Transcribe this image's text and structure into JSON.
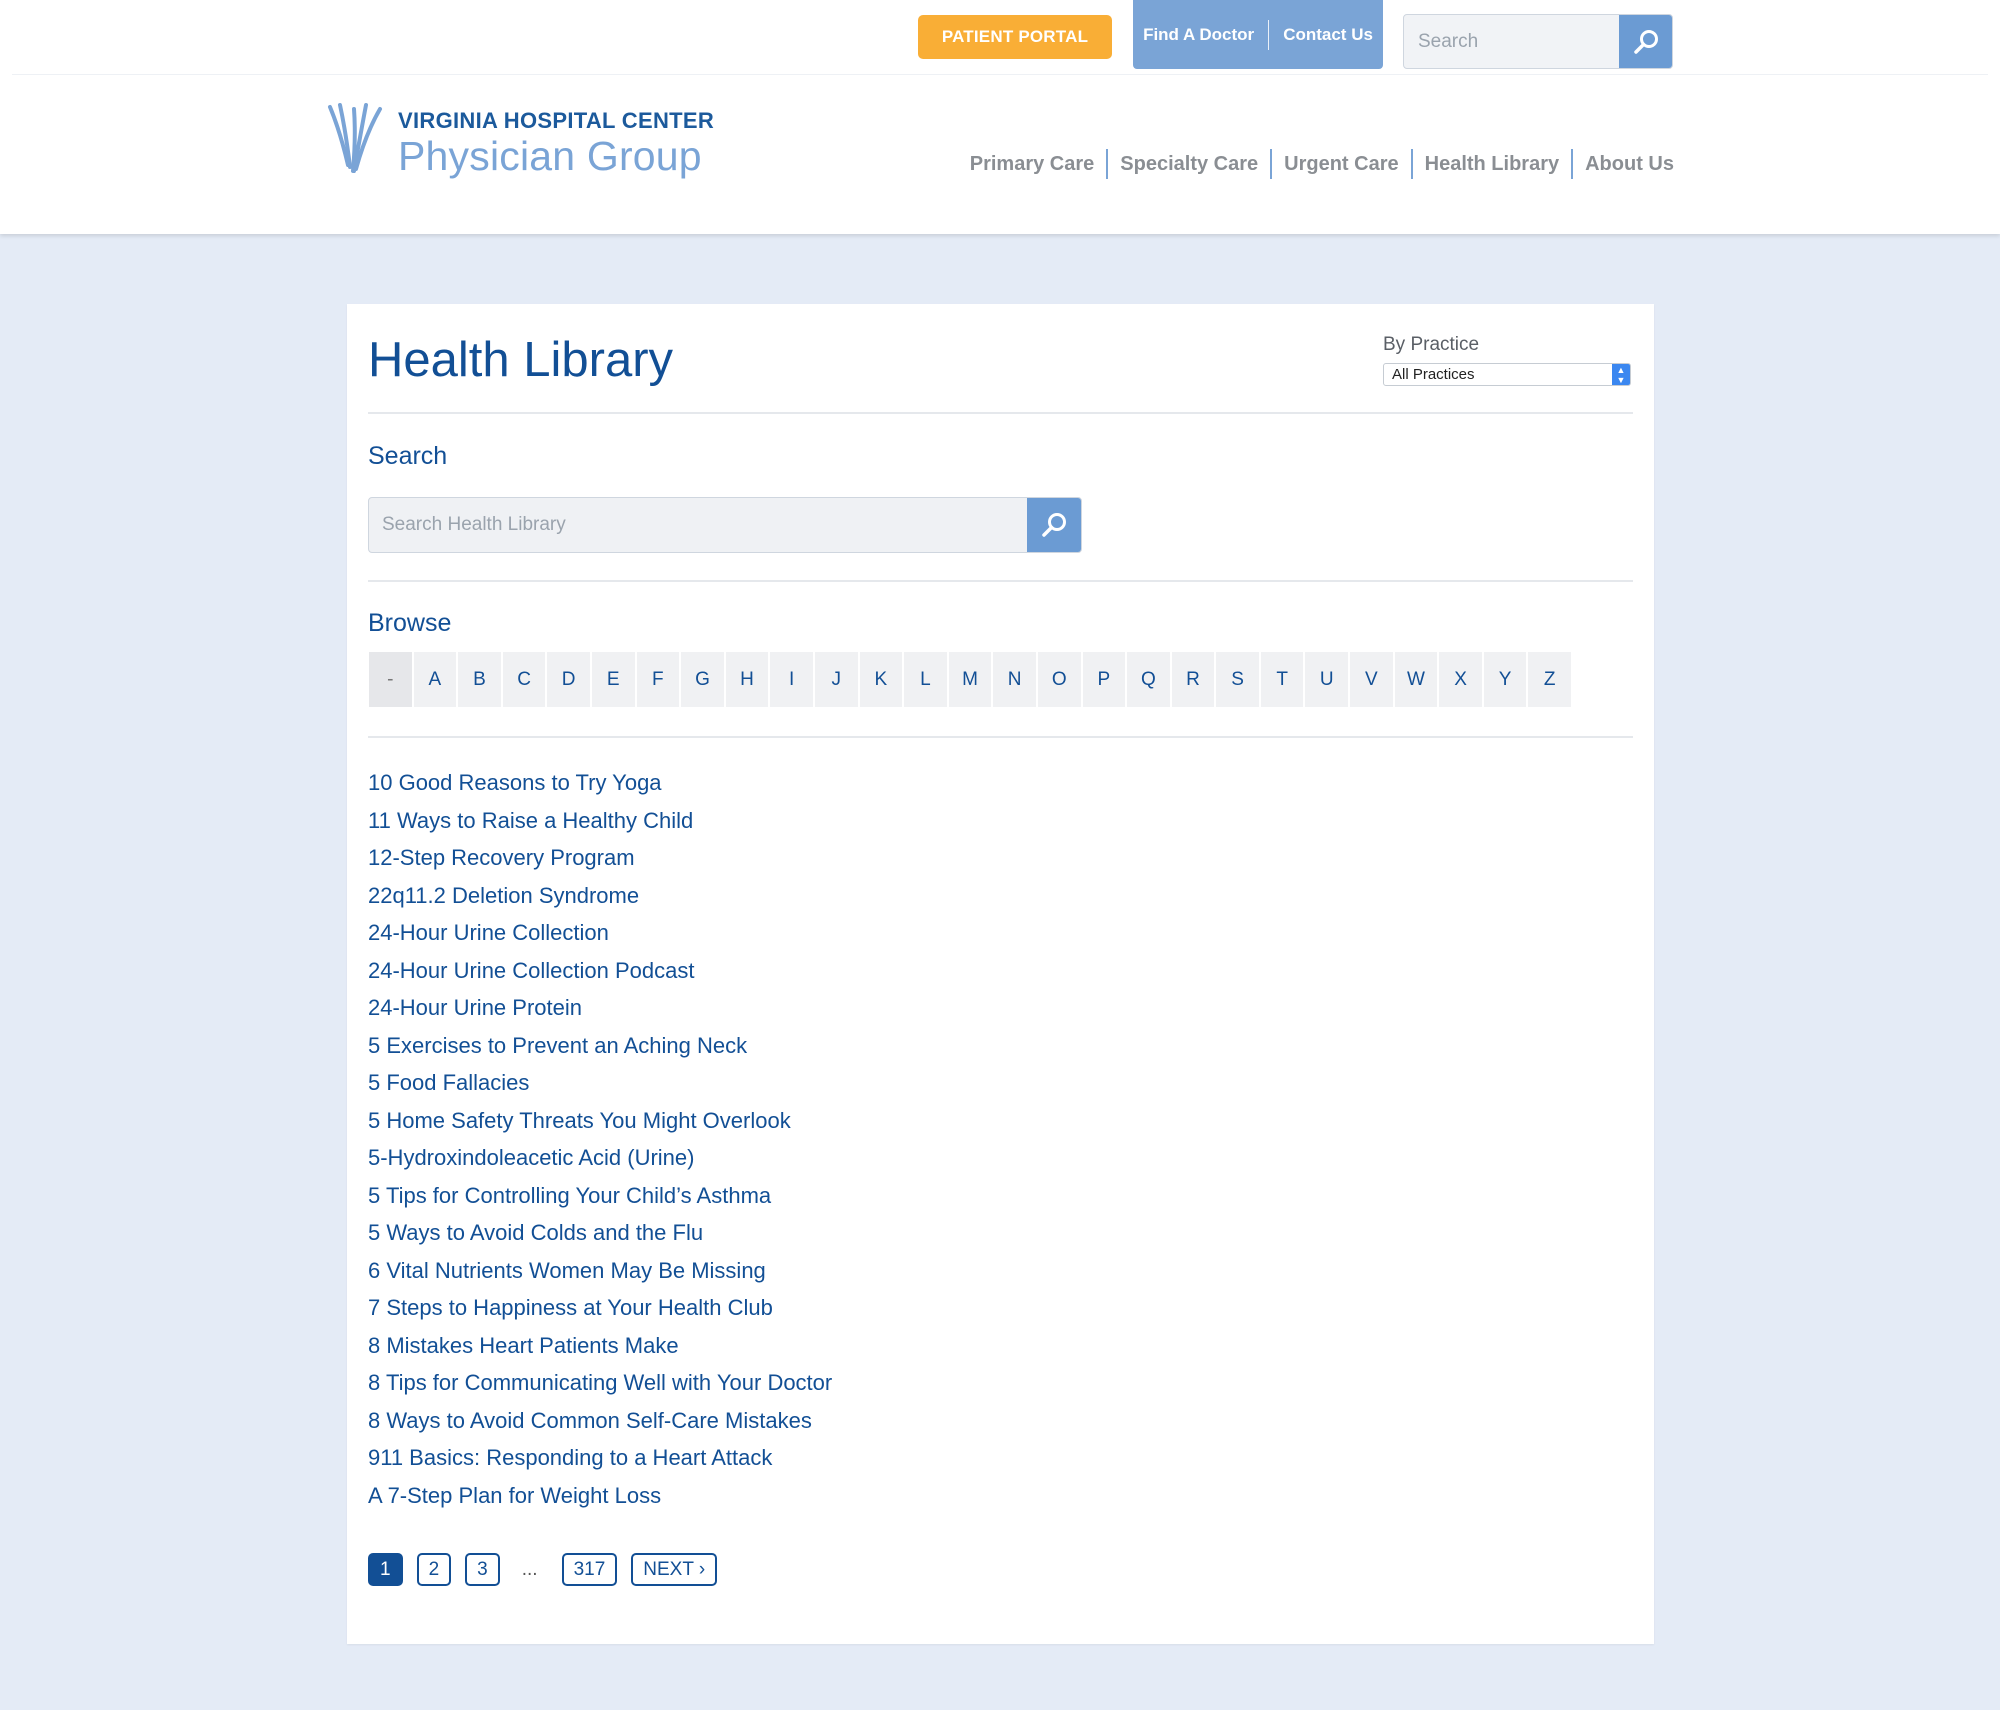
{
  "header": {
    "patient_portal": "PATIENT PORTAL",
    "find_doctor": "Find A Doctor",
    "contact_us": "Contact Us",
    "search_placeholder": "Search",
    "logo_line1": "VIRGINIA HOSPITAL CENTER",
    "logo_line2": "Physician Group",
    "nav": [
      "Primary Care",
      "Specialty Care",
      "Urgent Care",
      "Health Library",
      "About Us"
    ]
  },
  "page": {
    "title": "Health Library",
    "practice_label": "By Practice",
    "practice_selected": "All Practices",
    "search_heading": "Search",
    "search_placeholder": "Search Health Library",
    "browse_heading": "Browse",
    "letters": [
      "-",
      "A",
      "B",
      "C",
      "D",
      "E",
      "F",
      "G",
      "H",
      "I",
      "J",
      "K",
      "L",
      "M",
      "N",
      "O",
      "P",
      "Q",
      "R",
      "S",
      "T",
      "U",
      "V",
      "W",
      "X",
      "Y",
      "Z"
    ],
    "articles": [
      "10 Good Reasons to Try Yoga",
      "11 Ways to Raise a Healthy Child",
      "12-Step Recovery Program",
      "22q11.2 Deletion Syndrome",
      "24-Hour Urine Collection",
      "24-Hour Urine Collection Podcast",
      "24-Hour Urine Protein",
      "5 Exercises to Prevent an Aching Neck",
      "5 Food Fallacies",
      "5 Home Safety Threats You Might Overlook",
      "5-Hydroxindoleacetic Acid (Urine)",
      "5 Tips for Controlling Your Child’s Asthma",
      "5 Ways to Avoid Colds and the Flu",
      "6 Vital Nutrients Women May Be Missing",
      "7 Steps to Happiness at Your Health Club",
      "8 Mistakes Heart Patients Make",
      "8 Tips for Communicating Well with Your Doctor",
      "8 Ways to Avoid Common Self-Care Mistakes",
      "911 Basics: Responding to a Heart Attack",
      "A 7-Step Plan for Weight Loss"
    ],
    "pagination": {
      "pages": [
        "1",
        "2",
        "3"
      ],
      "ellipsis": "...",
      "last": "317",
      "next": "NEXT ›"
    }
  },
  "colors": {
    "brand_blue": "#124f95",
    "accent_blue": "#7aa4d6",
    "portal_orange": "#f9ae36",
    "background": "#e4ebf6"
  },
  "icons": {
    "search": "search-icon",
    "logo_mark": "vhc-logo-icon",
    "select_arrows": "chevron-up-down-icon"
  }
}
